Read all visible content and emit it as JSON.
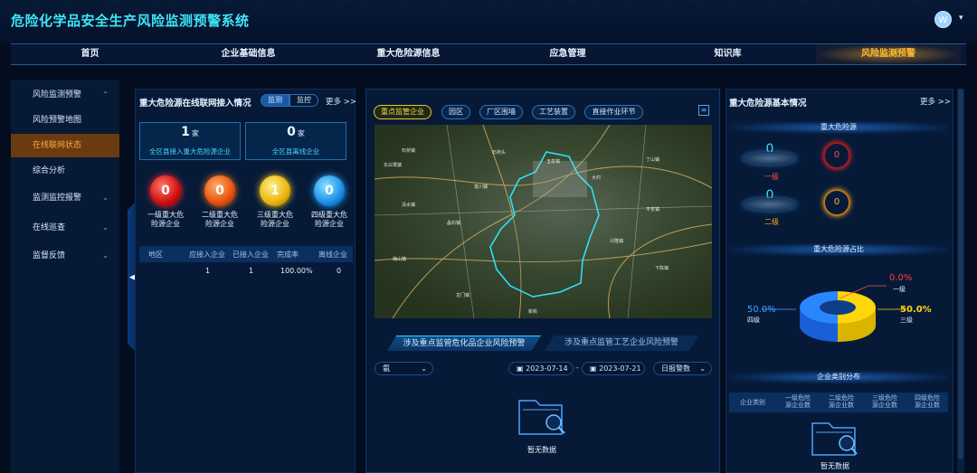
{
  "header": {
    "title": "危险化学品安全生产风险监测预警系统",
    "avatar": "W"
  },
  "nav": [
    "首页",
    "企业基础信息",
    "重大危险源信息",
    "应急管理",
    "知识库",
    "风险监测预警"
  ],
  "sidebar": {
    "items": [
      {
        "label": "风险监测预警",
        "chev": "⌃"
      },
      {
        "label": "风险预警地图",
        "chev": ""
      },
      {
        "label": "在线联网状态",
        "chev": ""
      },
      {
        "label": "综合分析",
        "chev": ""
      },
      {
        "label": "监测监控报警",
        "chev": "⌄"
      },
      {
        "label": "在线巡查",
        "chev": "⌄"
      },
      {
        "label": "监督反馈",
        "chev": "⌄"
      }
    ],
    "collapse_arrow": "◀"
  },
  "left": {
    "title": "重大危险源在线联网接入情况",
    "toggle": [
      "监测",
      "监控"
    ],
    "more": "更多 >>",
    "stat1": {
      "value": "1",
      "unit": "家",
      "label": "全区县接入重大危险源企业"
    },
    "stat2": {
      "value": "0",
      "unit": "家",
      "label": "全区县离线企业"
    },
    "levels": [
      {
        "value": "0",
        "label1": "一级重大危",
        "label2": "险源企业"
      },
      {
        "value": "0",
        "label1": "二级重大危",
        "label2": "险源企业"
      },
      {
        "value": "1",
        "label1": "三级重大危",
        "label2": "险源企业"
      },
      {
        "value": "0",
        "label1": "四级重大危",
        "label2": "险源企业"
      }
    ],
    "table": {
      "headers": [
        "地区",
        "应接入企业",
        "已接入企业",
        "完成率",
        "离线企业"
      ],
      "row": [
        "",
        "1",
        "1",
        "100.00%",
        "0"
      ]
    }
  },
  "center": {
    "tabs": [
      "重点监管企业",
      "园区",
      "厂区围墙",
      "工艺装置",
      "直接作业环节"
    ],
    "map_places": [
      "石桥镇",
      "石桥头",
      "玉泉镇",
      "东白鹭镇",
      "丁山镇",
      "富川镇",
      "大村",
      "清水镇",
      "平安镇",
      "晶石镇",
      "兴隆镇",
      "梅山镇",
      "下陈镇",
      "龙门镇",
      "新街"
    ],
    "bottom_tabs": [
      "涉及重点监管危化品企业风险预警",
      "涉及重点监管工艺企业风险预警"
    ],
    "select": "氨",
    "date_from": "2023-07-14",
    "date_to": "2023-07-21",
    "report": "日报警数",
    "empty": "暂无数据"
  },
  "right": {
    "title": "重大危险源基本情况",
    "more": "更多 >>",
    "sect1": "重大危险源",
    "grade1": {
      "value": "0",
      "label": "一级",
      "ring": "0"
    },
    "grade2": {
      "value": "0",
      "label": "二级",
      "ring": "0"
    },
    "sect2": "重大危险源占比",
    "pie": {
      "pct_top": "0.0%",
      "label_top": "一级",
      "pct_left": "50.0%",
      "label_left": "四级",
      "pct_right": "50.0%",
      "label_right": "三级"
    },
    "sect3": "企业类别分布",
    "table_headers": [
      "企业类别",
      "一级危险\n源企业数",
      "二级危险\n源企业数",
      "三级危险\n源企业数",
      "四级危险\n源企业数"
    ],
    "empty": "暂无数据"
  }
}
